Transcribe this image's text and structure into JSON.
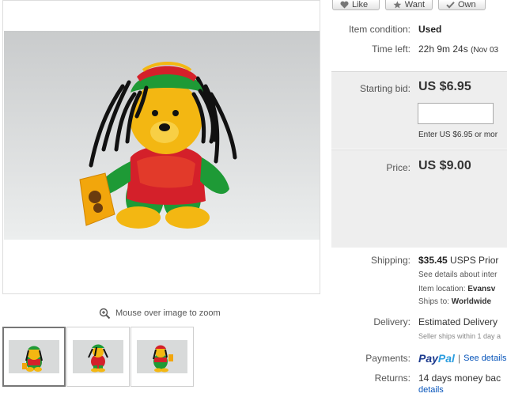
{
  "social": {
    "like": "Like",
    "want": "Want",
    "own": "Own"
  },
  "gallery": {
    "zoom_hint": "Mouse over image to zoom",
    "thumbnails": [
      "front view",
      "side view",
      "back view"
    ]
  },
  "details": {
    "condition_label": "Item condition:",
    "condition_value": "Used",
    "time_left_label": "Time left:",
    "time_left_value": "22h 9m 24s",
    "time_left_end": "(Nov 03",
    "starting_bid_label": "Starting bid:",
    "starting_bid_value": "US $6.95",
    "bid_input_value": "",
    "bid_hint": "Enter US $6.95 or mor",
    "price_label": "Price:",
    "price_value": "US $9.00",
    "shipping_label": "Shipping:",
    "shipping_cost": "$35.45",
    "shipping_service": "USPS Prior",
    "shipping_details_link": "See details about inter",
    "item_location_label": "Item location:",
    "item_location_value": "Evansv",
    "ships_to_label": "Ships to:",
    "ships_to_value": "Worldwide",
    "delivery_label": "Delivery:",
    "delivery_value": "Estimated Delivery",
    "delivery_note": "Seller ships within 1 day a",
    "payments_label": "Payments:",
    "paypal_pay": "Pay",
    "paypal_pal": "Pal",
    "payments_separator": "|",
    "payments_link": "See details",
    "returns_label": "Returns:",
    "returns_value": "14 days money bac",
    "returns_link": "details"
  },
  "colors": {
    "link": "#0654ba",
    "panel_bg": "#eeeeee",
    "paypal_dark": "#1c3a8e",
    "paypal_light": "#2c9ee0",
    "bear_green": "#1e9a36",
    "bear_red": "#d4202a",
    "bear_yellow": "#f3b712"
  }
}
